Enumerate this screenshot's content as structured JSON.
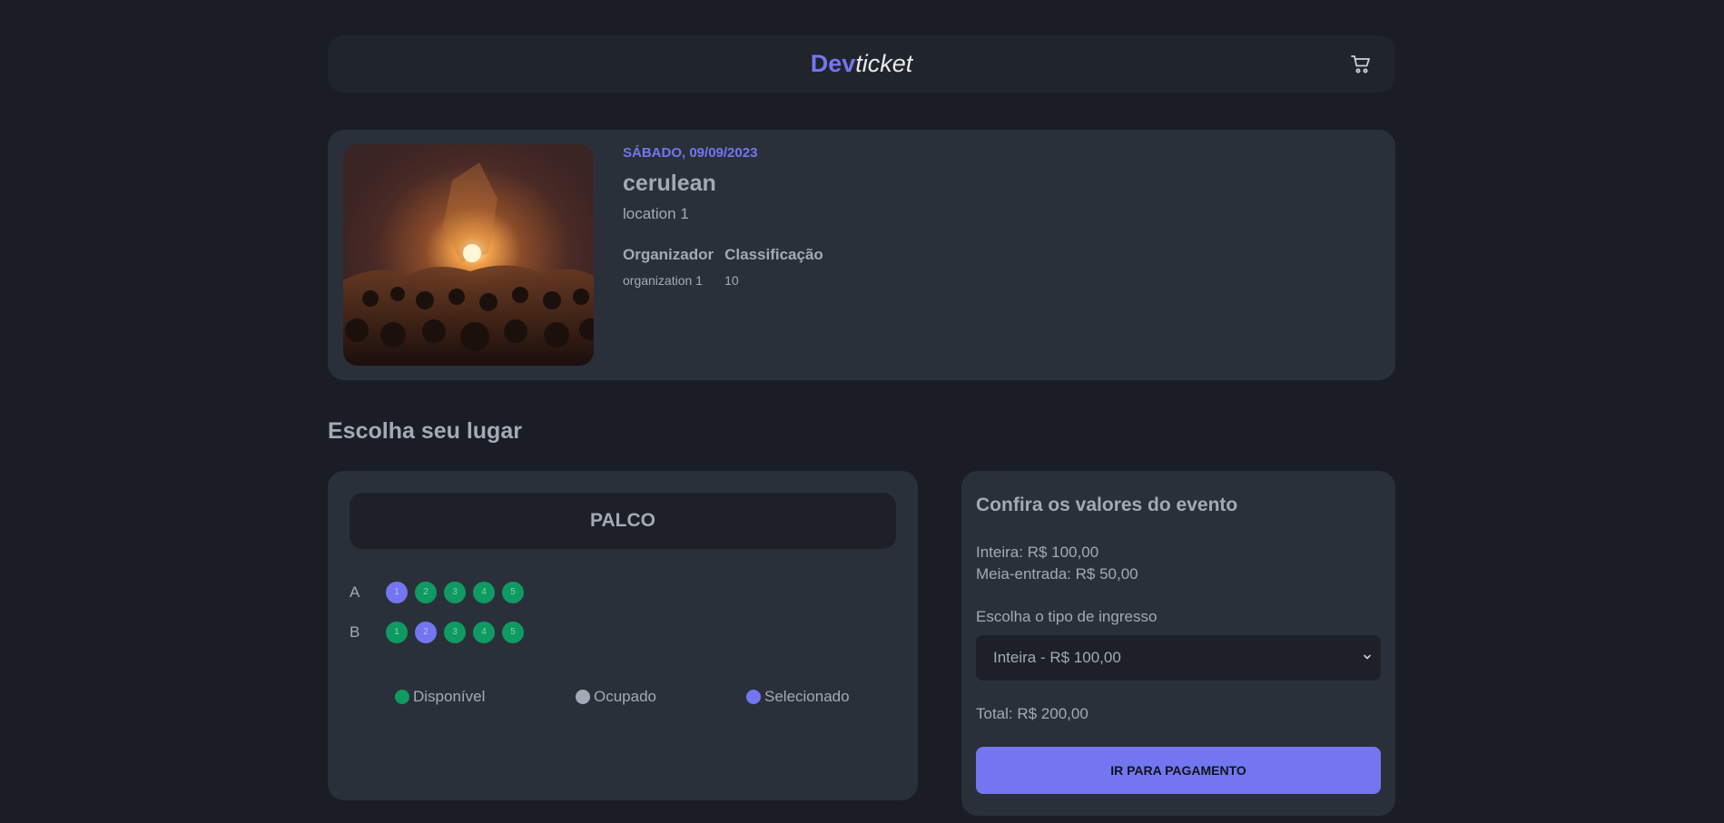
{
  "header": {
    "logo_dev": "Dev",
    "logo_ticket": "ticket",
    "cart_icon": "cart-icon"
  },
  "event": {
    "date": "SÁBADO, 09/09/2023",
    "name": "cerulean",
    "location": "location 1",
    "organizer_label": "Organizador",
    "organizer_value": "organization 1",
    "rating_label": "Classificação",
    "rating_value": "10"
  },
  "seats": {
    "section_title": "Escolha seu lugar",
    "stage_label": "PALCO",
    "rows": [
      {
        "label": "A",
        "seats": [
          {
            "number": "1",
            "status": "selected"
          },
          {
            "number": "2",
            "status": "available"
          },
          {
            "number": "3",
            "status": "available"
          },
          {
            "number": "4",
            "status": "available"
          },
          {
            "number": "5",
            "status": "available"
          }
        ]
      },
      {
        "label": "B",
        "seats": [
          {
            "number": "1",
            "status": "available"
          },
          {
            "number": "2",
            "status": "selected"
          },
          {
            "number": "3",
            "status": "available"
          },
          {
            "number": "4",
            "status": "available"
          },
          {
            "number": "5",
            "status": "available"
          }
        ]
      }
    ],
    "legend": {
      "available": "Disponível",
      "occupied": "Ocupado",
      "selected": "Selecionado"
    }
  },
  "prices": {
    "title": "Confira os valores do evento",
    "full": "Inteira: R$ 100,00",
    "half": "Meia-entrada: R$ 50,00",
    "select_label": "Escolha o tipo de ingresso",
    "select_value": "Inteira - R$ 100,00",
    "total": "Total: R$ 200,00",
    "pay_button": "IR PARA PAGAMENTO"
  },
  "colors": {
    "accent": "#7376f0",
    "available": "#0f9a62",
    "occupied": "#a3aab6",
    "selected": "#7376f0",
    "background": "#1a1d24",
    "card": "#2a3039"
  }
}
